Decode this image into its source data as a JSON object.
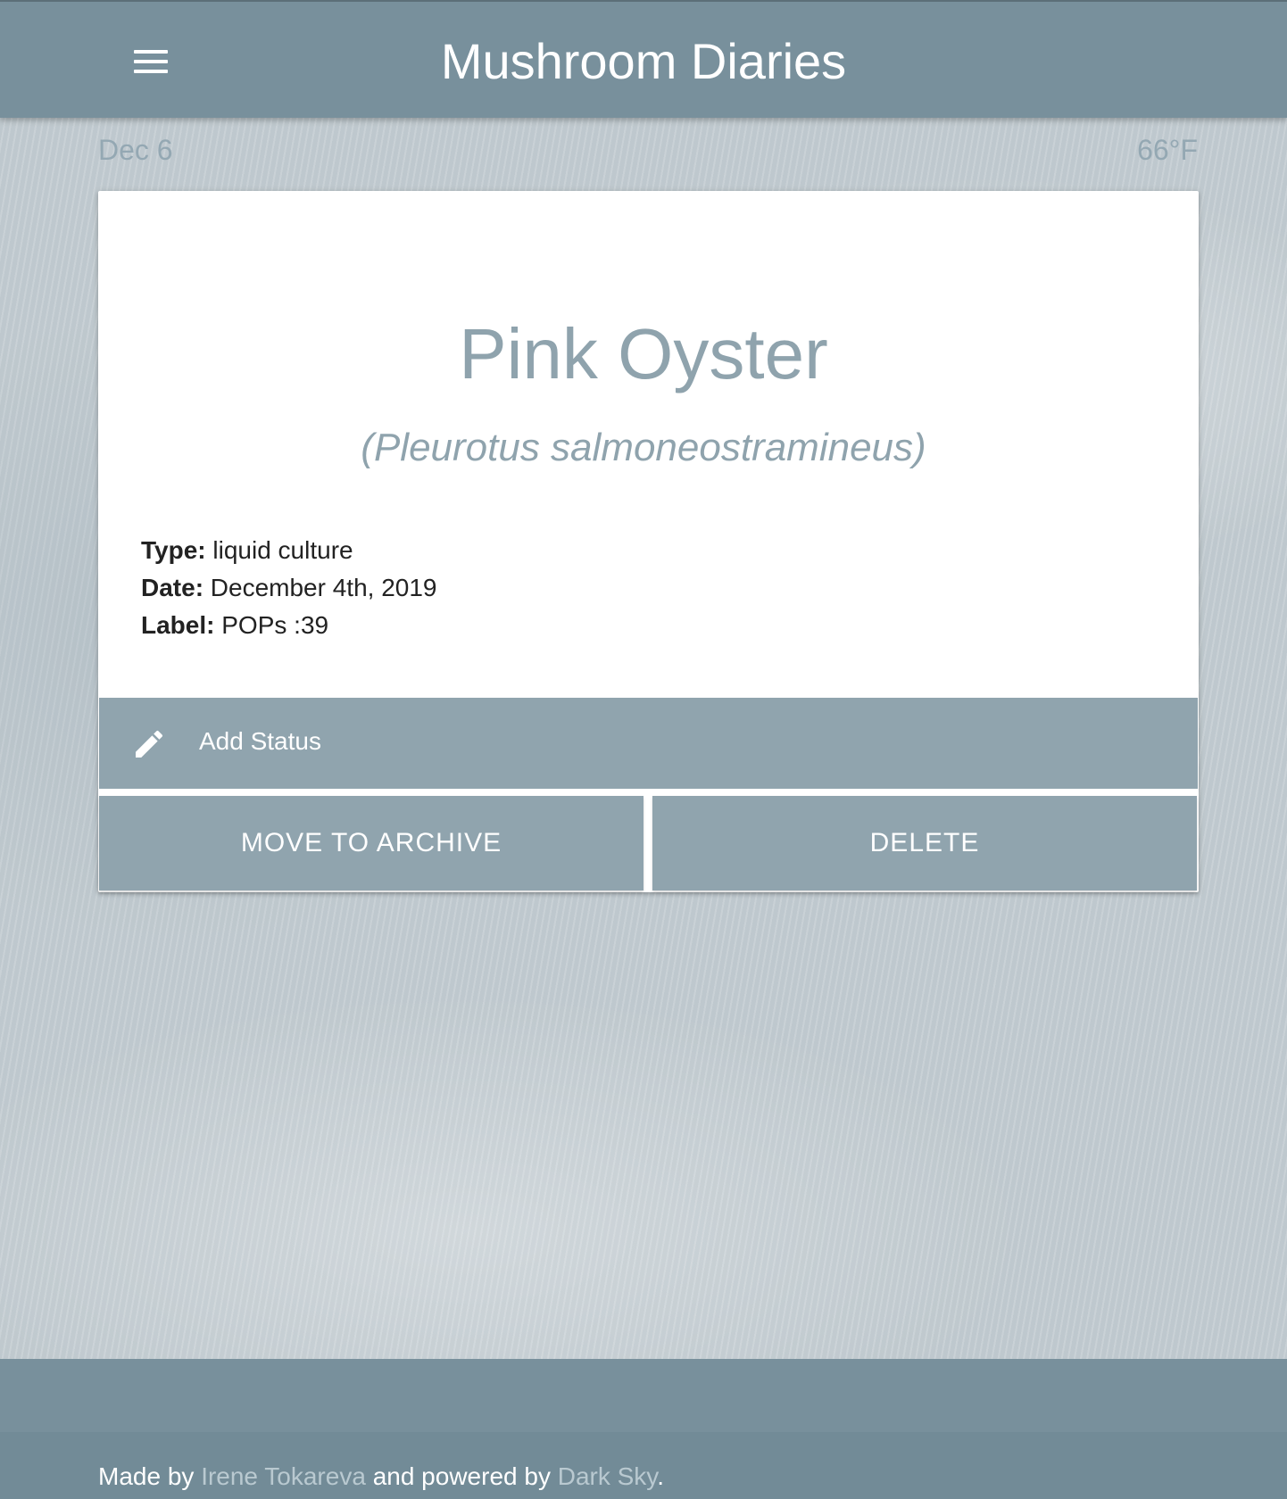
{
  "header": {
    "menu_icon": "hamburger-menu-icon",
    "title": "Mushroom Diaries"
  },
  "info_bar": {
    "date": "Dec 6",
    "temperature": "66°F"
  },
  "card": {
    "title": "Pink Oyster",
    "scientific_name": "(Pleurotus salmoneostramineus)",
    "details": [
      {
        "label": "Type:",
        "value": "liquid culture"
      },
      {
        "label": "Date:",
        "value": "December 4th, 2019"
      },
      {
        "label": "Label:",
        "value": "POPs :39"
      }
    ],
    "add_status": {
      "icon": "pencil-icon",
      "label": "Add Status"
    },
    "archive_button": "MOVE TO ARCHIVE",
    "delete_button": "DELETE"
  },
  "footer": {
    "prefix": "Made by",
    "author": "Irene Tokareva",
    "middle": "and powered by",
    "service": "Dark Sky",
    "suffix": "."
  },
  "colors": {
    "primary": "#78909c",
    "button": "#90a4ae",
    "muted_text": "#8fa3ad"
  }
}
